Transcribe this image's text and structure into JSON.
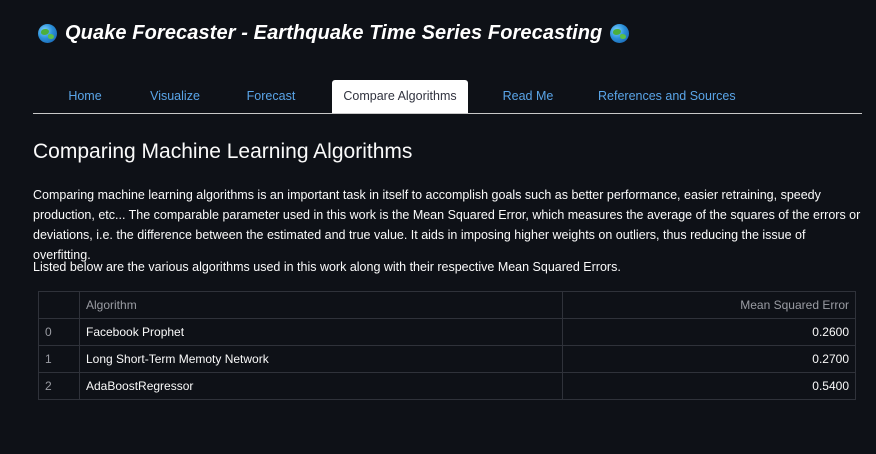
{
  "header": {
    "title": "Quake Forecaster - Earthquake Time Series Forecasting"
  },
  "tabs": [
    {
      "label": "Home",
      "active": false
    },
    {
      "label": "Visualize",
      "active": false
    },
    {
      "label": "Forecast",
      "active": false
    },
    {
      "label": "Compare Algorithms",
      "active": true
    },
    {
      "label": "Read Me",
      "active": false
    },
    {
      "label": "References and Sources",
      "active": false
    }
  ],
  "main": {
    "heading": "Comparing Machine Learning Algorithms",
    "paragraph1": "Comparing machine learning algorithms is an important task in itself to accomplish goals such as better performance, easier retraining, speedy production, etc... The comparable parameter used in this work is the Mean Squared Error, which measures the average of the squares of the errors or deviations, i.e. the difference between the estimated and true value. It aids in imposing higher weights on outliers, thus reducing the issue of overfitting.",
    "paragraph2": "Listed below are the various algorithms used in this work along with their respective Mean Squared Errors.",
    "table": {
      "columns": [
        "",
        "Algorithm",
        "Mean Squared Error"
      ],
      "rows": [
        {
          "index": "0",
          "algorithm": "Facebook Prophet",
          "mse": "0.2600"
        },
        {
          "index": "1",
          "algorithm": "Long Short-Term Memoty Network",
          "mse": "0.2700"
        },
        {
          "index": "2",
          "algorithm": "AdaBoostRegressor",
          "mse": "0.5400"
        }
      ]
    }
  },
  "colors": {
    "background": "#0e1117",
    "link": "#5aa5e8",
    "active_tab_bg": "#ffffff",
    "text": "#fafafa"
  },
  "icons": {
    "title_left": "globe-icon",
    "title_right": "globe-icon"
  }
}
